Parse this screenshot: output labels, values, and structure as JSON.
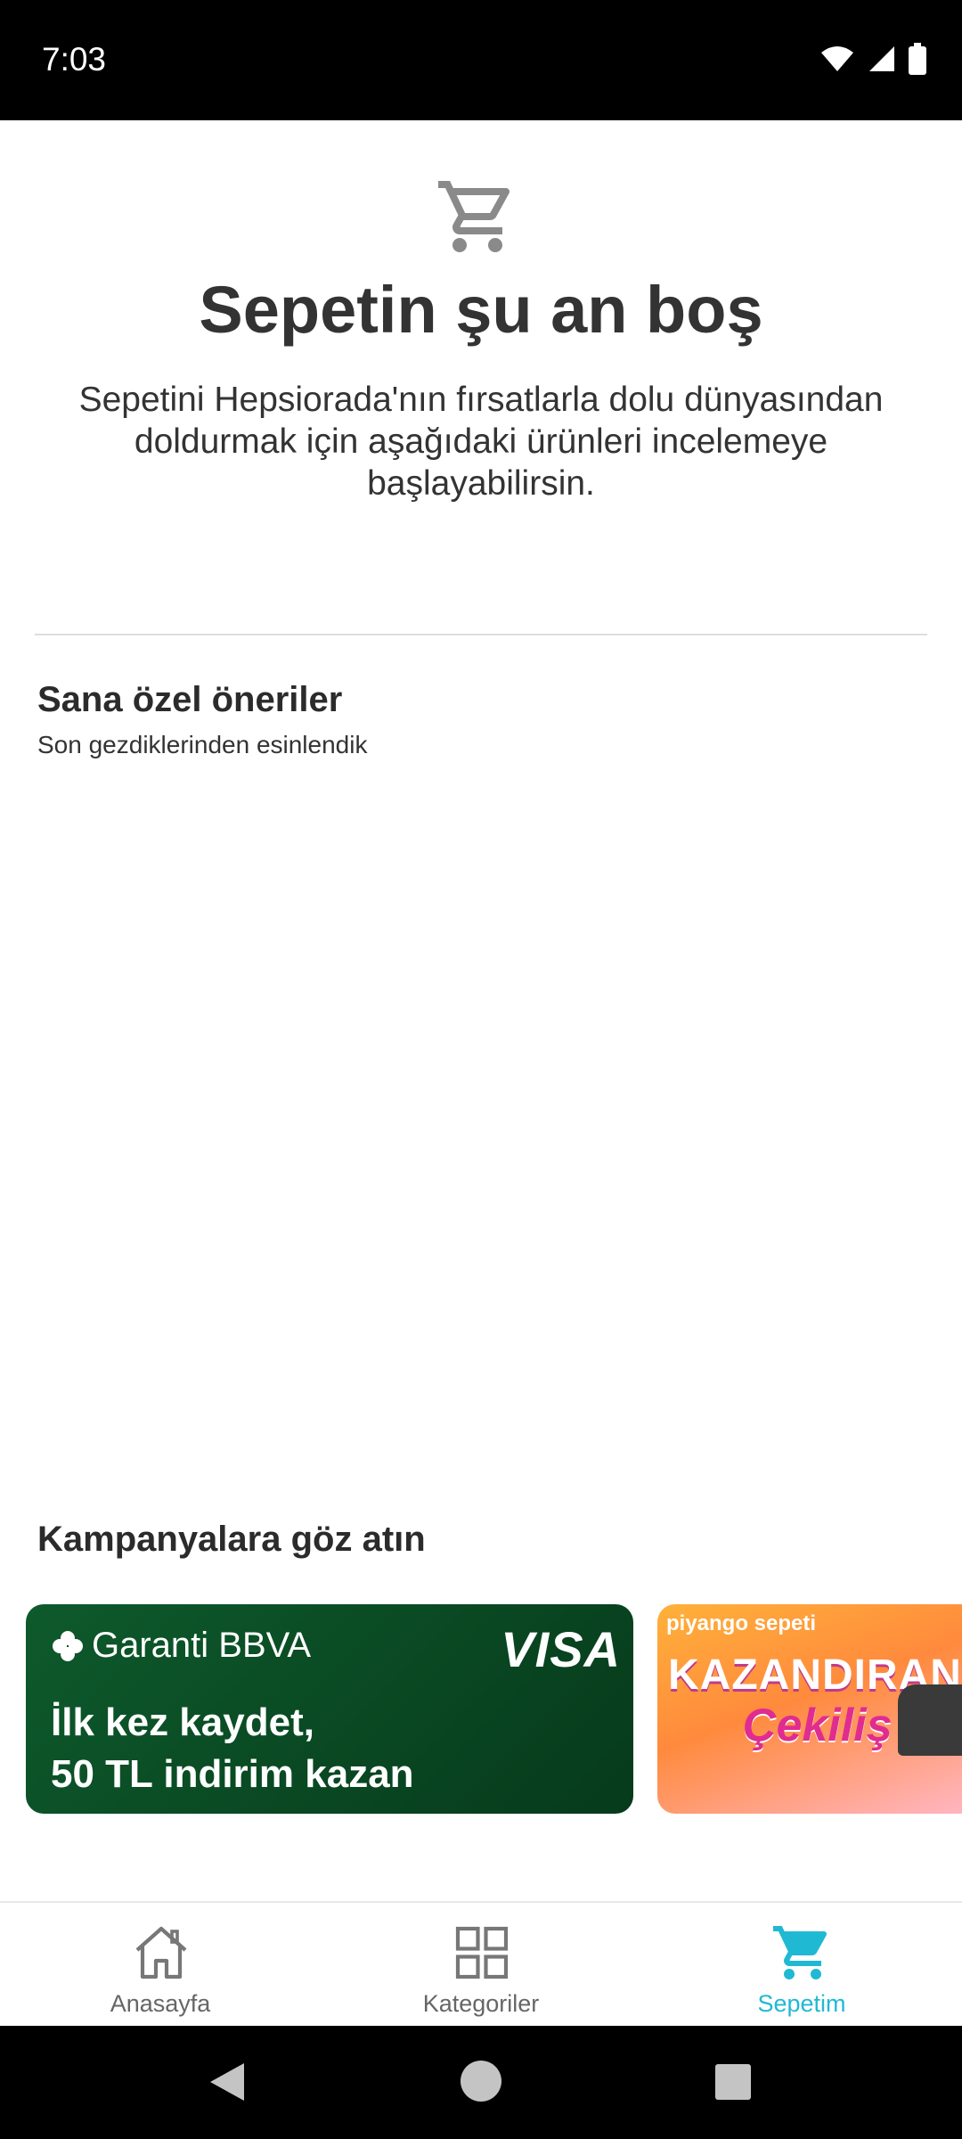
{
  "status_bar": {
    "time": "7:03"
  },
  "empty_cart": {
    "icon": "shopping-cart-icon",
    "title": "Sepetin şu an boş",
    "description": "Sepetini Hepsiorada'nın fırsatlarla dolu dünyasından doldurmak için aşağıdaki ürünleri incelemeye başlayabilirsin."
  },
  "recommendations": {
    "title": "Sana özel öneriler",
    "subtitle": "Son gezdiklerinden esinlendik"
  },
  "campaigns": {
    "title": "Kampanyalara göz atın",
    "banners": [
      {
        "brand": "Garanti BBVA",
        "badge": "VISA",
        "line1": "İlk kez kaydet,",
        "line2": "50 TL indirim kazan"
      },
      {
        "brand": "piyango sepeti",
        "headline": "KAZANDIRAN",
        "script": "Çekiliş"
      }
    ]
  },
  "bottom_nav": {
    "items": [
      {
        "label": "Anasayfa",
        "icon": "home-icon"
      },
      {
        "label": "Kategoriler",
        "icon": "grid-icon"
      },
      {
        "label": "Sepetim",
        "icon": "cart-icon",
        "active": true
      }
    ],
    "active_color": "#20b9d4"
  }
}
